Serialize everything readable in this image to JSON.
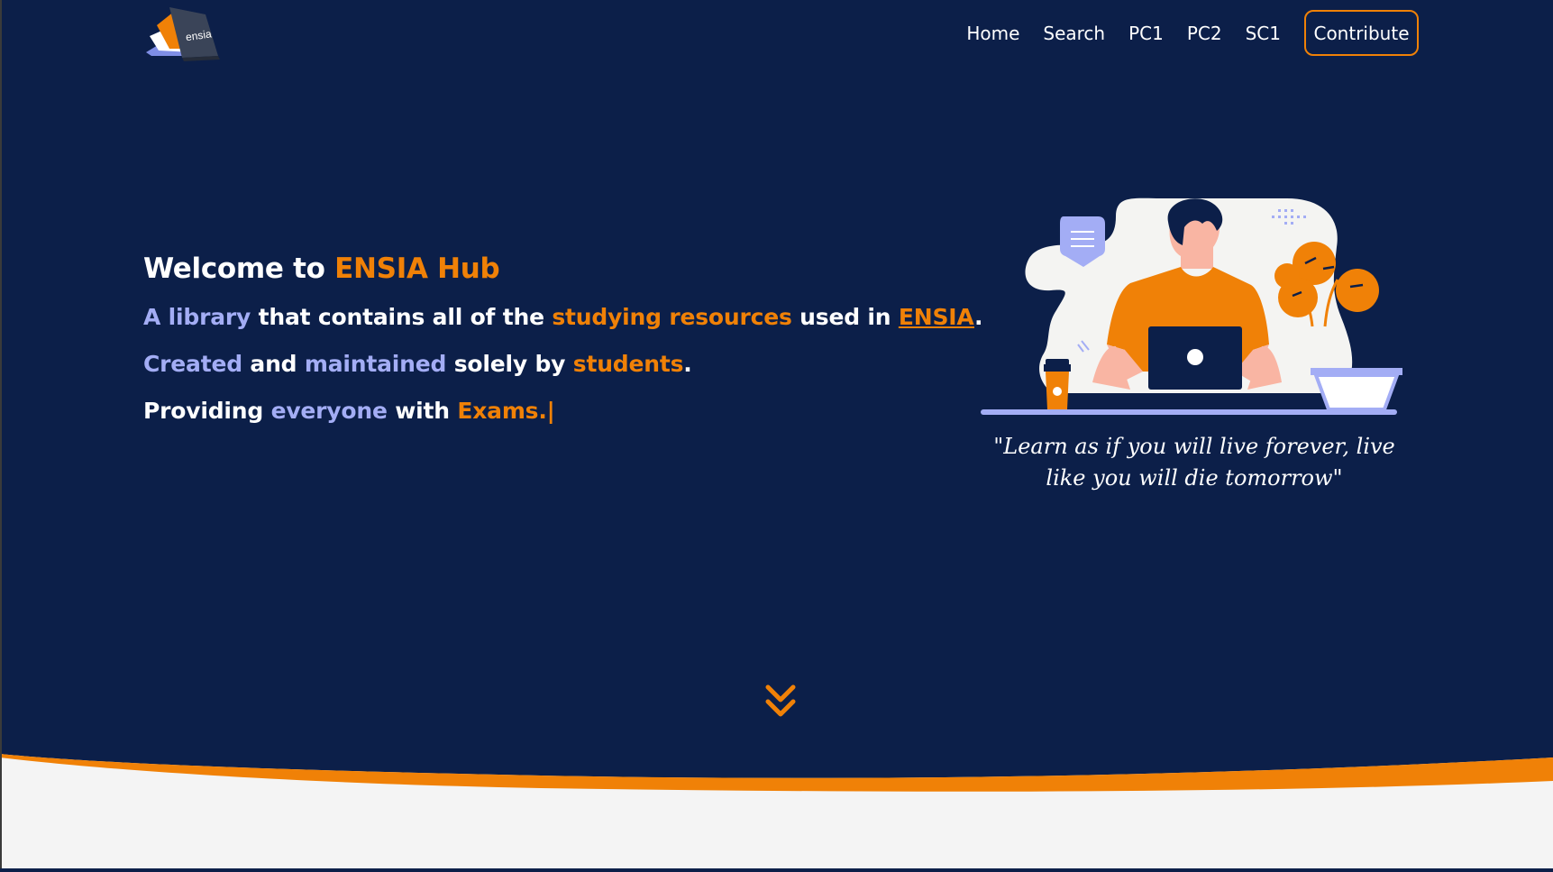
{
  "nav": {
    "logo_text": "ensia",
    "links": [
      {
        "label": "Home"
      },
      {
        "label": "Search"
      },
      {
        "label": "PC1"
      },
      {
        "label": "PC2"
      },
      {
        "label": "SC1"
      }
    ],
    "contribute_label": "Contribute"
  },
  "hero": {
    "title_prefix": "Welcome to ",
    "title_brand": "ENSIA Hub",
    "line1": {
      "p1": "A library",
      "p2": " that contains all of the ",
      "p3": "studying resources",
      "p4": " used in ",
      "p5": "ENSIA",
      "p6": "."
    },
    "line2": {
      "p1": "Created",
      "p2": " and ",
      "p3": "maintained",
      "p4": " solely by ",
      "p5": "students",
      "p6": "."
    },
    "line3": {
      "p1": "Providing ",
      "p2": "everyone",
      "p3": " with ",
      "p4": "Exams.",
      "cursor": "|"
    }
  },
  "quote": {
    "text": "\"Learn as if you will live forever, live like you will die tomorrow\""
  },
  "icons": {
    "scroll": "double-chevron-down-icon",
    "illustration": "student-laptop-illustration"
  },
  "colors": {
    "background": "#0c1f49",
    "accent_orange": "#f08107",
    "accent_purple": "#a3adf5",
    "footer_bg": "#f4f4f4"
  }
}
